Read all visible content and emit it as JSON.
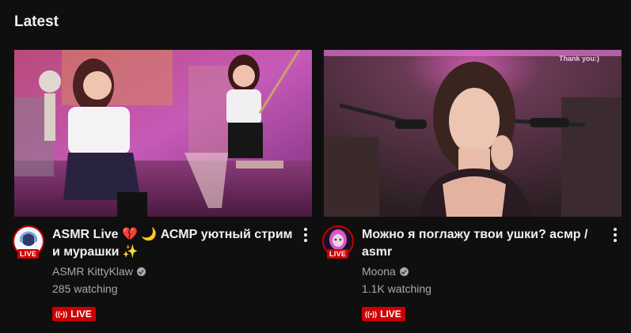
{
  "section": {
    "title": "Latest"
  },
  "cards": [
    {
      "title": "ASMR Live 💔 🌙 АСМР уютный стрим и мурашки ✨",
      "channel": "ASMR KittyKlaw",
      "watching": "285 watching",
      "avatar_badge": "LIVE",
      "live_label": "LIVE",
      "live_icon": "live-waves-icon"
    },
    {
      "title": "Можно я поглажу твои ушки? асмр / asmr",
      "channel": "Moona",
      "watching": "1.1K watching",
      "avatar_badge": "LIVE",
      "live_label": "LIVE",
      "live_icon": "live-waves-icon",
      "overlay_text": "Thank you:)"
    }
  ],
  "colors": {
    "background": "#0f0f0f",
    "live_red": "#cc0000",
    "secondary_text": "#aaaaaa"
  }
}
